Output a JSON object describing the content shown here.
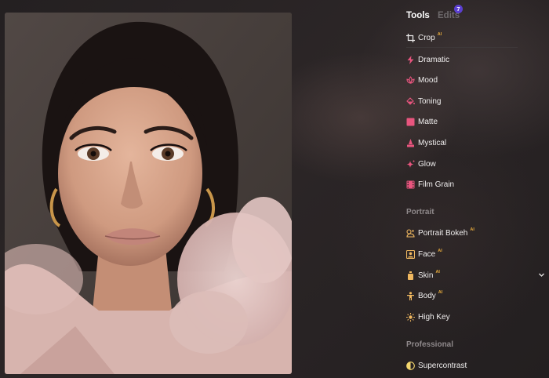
{
  "tabs": {
    "tools_label": "Tools",
    "edits_label": "Edits",
    "edits_badge": "7"
  },
  "tools_list": [
    {
      "label": "Crop",
      "ai": "AI",
      "icon": "crop-icon",
      "color": "#e8e6e6"
    },
    {
      "label": "Dramatic",
      "icon": "lightning-icon",
      "color": "#e8557e"
    },
    {
      "label": "Mood",
      "icon": "lotus-icon",
      "color": "#e8557e"
    },
    {
      "label": "Toning",
      "icon": "paint-bucket-icon",
      "color": "#e8557e"
    },
    {
      "label": "Matte",
      "icon": "square-icon",
      "color": "#e8557e"
    },
    {
      "label": "Mystical",
      "icon": "wizard-icon",
      "color": "#e8557e"
    },
    {
      "label": "Glow",
      "icon": "sparkle-icon",
      "color": "#e8557e"
    },
    {
      "label": "Film Grain",
      "icon": "film-icon",
      "color": "#e8557e"
    }
  ],
  "portrait_section": {
    "title": "Portrait",
    "items": [
      {
        "label": "Portrait Bokeh",
        "ai": "AI",
        "icon": "bokeh-icon",
        "color": "#f0b860"
      },
      {
        "label": "Face",
        "ai": "AI",
        "icon": "face-icon",
        "color": "#f0b860"
      },
      {
        "label": "Skin",
        "ai": "AI",
        "icon": "skin-bottle-icon",
        "color": "#f0b860"
      },
      {
        "label": "Body",
        "ai": "AI",
        "icon": "body-icon",
        "color": "#f0b860"
      },
      {
        "label": "High Key",
        "icon": "sun-icon",
        "color": "#f0b860"
      }
    ]
  },
  "professional_section": {
    "title": "Professional",
    "items": [
      {
        "label": "Supercontrast",
        "icon": "contrast-icon",
        "color": "#f5d76e"
      }
    ]
  },
  "colors": {
    "accent_pink": "#e8557e",
    "accent_orange": "#f0b860",
    "ai_badge": "#e4a93c",
    "badge_purple": "#5b3fd0"
  }
}
